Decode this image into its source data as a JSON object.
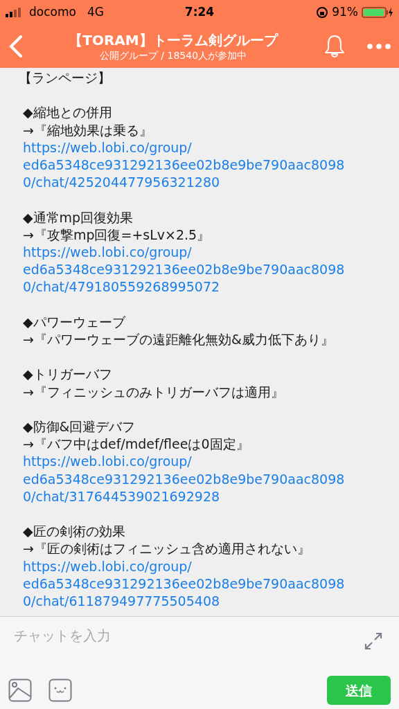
{
  "status_bar": {
    "carrier": "docomo",
    "network": "4G",
    "time": "7:24",
    "battery_percent": "91%"
  },
  "header": {
    "title": "【TORAM】トーラム剣グループ",
    "subtitle": "公開グループ / 18540人が参加中"
  },
  "message": {
    "title": "【ランページ】",
    "sections": [
      {
        "heading": "◆縮地との併用",
        "note": "→『縮地効果は乗る』",
        "link_lines": [
          "https://web.lobi.co/group/",
          "ed6a5348ce931292136ee02b8e9be790aac8098",
          "0/chat/425204477956321280"
        ]
      },
      {
        "heading": "◆通常mp回復効果",
        "note": "→『攻撃mp回復=+sLv×2.5』",
        "link_lines": [
          "https://web.lobi.co/group/",
          "ed6a5348ce931292136ee02b8e9be790aac8098",
          "0/chat/479180559268995072"
        ]
      },
      {
        "heading": "◆パワーウェーブ",
        "note": "→『パワーウェーブの遠距離化無効&威力低下あり』"
      },
      {
        "heading": "◆トリガーバフ",
        "note": "→『フィニッシュのみトリガーバフは適用』"
      },
      {
        "heading": "◆防御&回避デバフ",
        "note": "→『バフ中はdef/mdef/fleeは0固定』",
        "link_lines": [
          "https://web.lobi.co/group/",
          "ed6a5348ce931292136ee02b8e9be790aac8098",
          "0/chat/317644539021692928"
        ]
      },
      {
        "heading": "◆匠の剣術の効果",
        "note": "→『匠の剣術はフィニッシュ含め適用されない』",
        "link_lines": [
          "https://web.lobi.co/group/",
          "ed6a5348ce931292136ee02b8e9be790aac8098",
          "0/chat/611879497775505408"
        ]
      }
    ]
  },
  "composer": {
    "placeholder": "チャットを入力",
    "send": "送信"
  }
}
